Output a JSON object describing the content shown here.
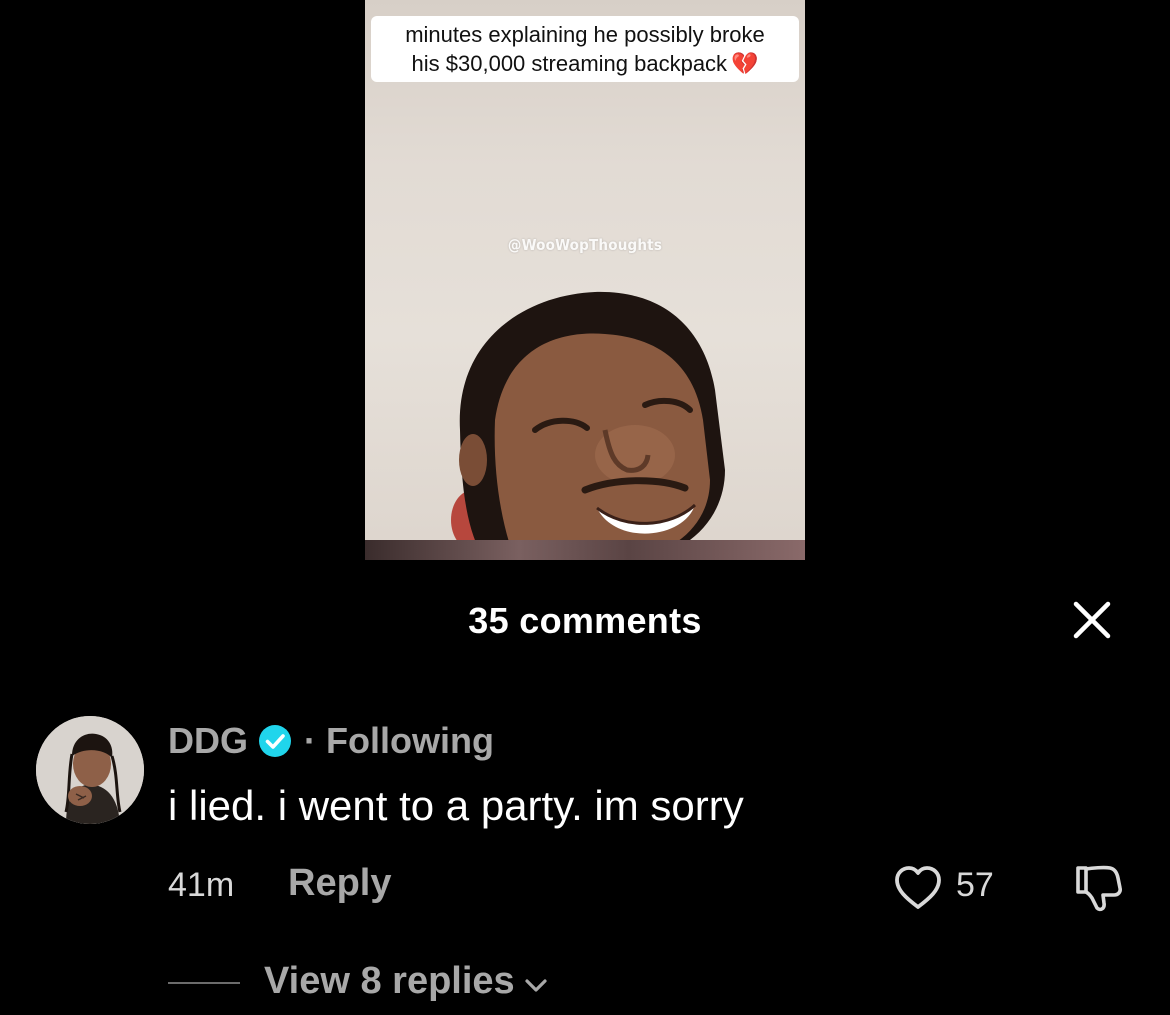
{
  "video": {
    "caption_line1": "minutes explaining he possibly broke",
    "caption_line2": "his $30,000 streaming backpack",
    "caption_emoji": "broken-heart-icon",
    "watermark": "@WooWopThoughts"
  },
  "comments_panel": {
    "title": "35 comments",
    "close_icon": "close-icon"
  },
  "comment": {
    "username": "DDG",
    "verified_icon": "verified-badge-icon",
    "separator": "·",
    "follow_status": "Following",
    "text": "i lied. i went to a party. im sorry",
    "time": "41m",
    "reply_label": "Reply",
    "like_icon": "heart-outline-icon",
    "like_count": "57",
    "dislike_icon": "thumbs-down-icon",
    "view_replies_label": "View 8 replies",
    "view_replies_icon": "chevron-down-icon"
  },
  "colors": {
    "background": "#000000",
    "primary_text": "#ffffff",
    "secondary_text": "#a8a8a8",
    "verified_blue": "#20d5ec",
    "broken_heart": "#e0243a"
  }
}
